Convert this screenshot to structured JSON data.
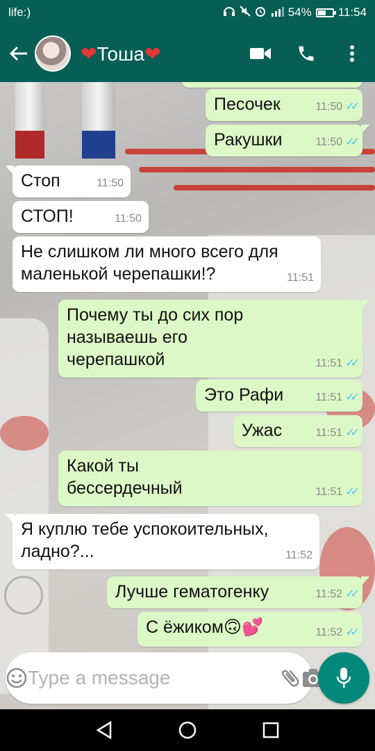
{
  "status_bar": {
    "carrier": "life:)",
    "battery": "54%",
    "battery_level": 0.54,
    "time": "11:54"
  },
  "header": {
    "back_icon": "arrow-back-icon",
    "contact_name": "Тоша",
    "heart": "❤",
    "icons": [
      "video-call-icon",
      "phone-icon",
      "more-vert-icon"
    ]
  },
  "messages": [
    {
      "dir": "out",
      "text": "Песочек",
      "time": "11:50"
    },
    {
      "dir": "out",
      "text": "Ракушки",
      "time": "11:50"
    },
    {
      "dir": "in",
      "text": "Стоп",
      "time": "11:50"
    },
    {
      "dir": "in",
      "text": "СТОП!",
      "time": "11:50"
    },
    {
      "dir": "in",
      "text": "Не слишком ли много всего для маленькой черепашки!?",
      "time": "11:51"
    },
    {
      "dir": "out",
      "text": "Почему ты до сих пор называешь его черепашкой",
      "time": "11:51"
    },
    {
      "dir": "out",
      "text": "Это Рафи",
      "time": "11:51"
    },
    {
      "dir": "out",
      "text": "Ужас",
      "time": "11:51"
    },
    {
      "dir": "out",
      "text": "Какой ты бессердечный",
      "time": "11:51"
    },
    {
      "dir": "in",
      "text": "Я куплю тебе успокоительных, ладно?...",
      "time": "11:52"
    },
    {
      "dir": "out",
      "text": "Лучше гематогенку",
      "time": "11:52"
    },
    {
      "dir": "out",
      "text": "С ёжиком🙃💕",
      "time": "11:52"
    }
  ],
  "composer": {
    "placeholder": "Type a message",
    "icons": [
      "emoji-icon",
      "attach-icon",
      "camera-icon",
      "mic-icon"
    ]
  },
  "colors": {
    "header": "#075e54",
    "outgoing_bubble": "#dcf8c6",
    "incoming_bubble": "#ffffff",
    "read_ticks": "#4fc3f7",
    "mic_button": "#00897b"
  },
  "nav_bar": {
    "icons": [
      "back-nav-icon",
      "home-nav-icon",
      "recents-nav-icon"
    ]
  }
}
